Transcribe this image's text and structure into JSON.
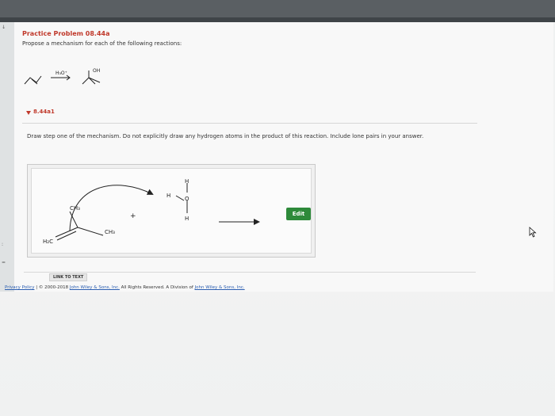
{
  "problem": {
    "title": "Practice Problem 08.44a",
    "subtitle": "Propose a mechanism for each of the following reactions:",
    "reagent": "H₃O⁺",
    "product_group": "OH"
  },
  "part": {
    "label": "8.44a1",
    "instructions": "Draw step one of the mechanism. Do not explicitly draw any hydrogen atoms in the product of this reaction. Include lone pairs in your answer."
  },
  "canvas": {
    "labels": {
      "ch3_top": "CH₃",
      "ch3_mid": "CH₃",
      "h2c": "H₂C",
      "plus": "+",
      "h_top": "H",
      "h_left": "H",
      "o": "O",
      "h_bottom": "H"
    },
    "edit_label": "Edit"
  },
  "link_to_text": "LINK TO TEXT",
  "footer": {
    "privacy": "Privacy Policy",
    "separator": "|",
    "copyright": "© 2000-2018",
    "company": "John Wiley & Sons, Inc.",
    "rights": "All Rights Reserved. A Division of",
    "company2": "John Wiley & Sons, Inc."
  },
  "colors": {
    "title": "#c0392b",
    "edit_button": "#2e8a3a",
    "link": "#2a5db0"
  }
}
